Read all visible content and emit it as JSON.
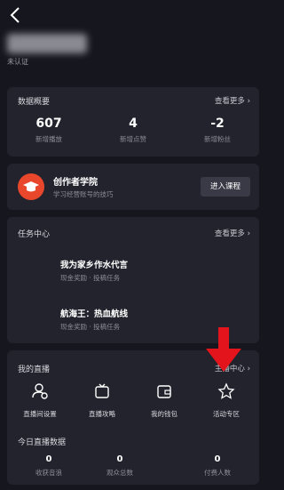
{
  "header": {
    "back_icon": "chevron-left-icon",
    "status": "未认证"
  },
  "data_overview": {
    "title": "数据概要",
    "more": "查看更多",
    "stats": [
      {
        "value": "607",
        "label": "新增播放"
      },
      {
        "value": "4",
        "label": "新增点赞"
      },
      {
        "value": "-2",
        "label": "新增粉丝"
      }
    ]
  },
  "academy": {
    "title": "创作者学院",
    "subtitle": "学习经营账号的技巧",
    "button": "进入课程",
    "icon": "graduation-cap-icon",
    "accent": "#e8472c"
  },
  "tasks": {
    "title": "任务中心",
    "more": "查看更多",
    "items": [
      {
        "title": "我为家乡作水代言",
        "subtitle": "现金奖励 · 投稿任务"
      },
      {
        "title": "航海王：热血航线",
        "subtitle": "现金奖励 · 投稿任务"
      }
    ]
  },
  "live": {
    "title": "我的直播",
    "more": "主播中心",
    "items": [
      {
        "label": "直播间设置",
        "icon": "user-settings-icon"
      },
      {
        "label": "直播攻略",
        "icon": "tv-icon"
      },
      {
        "label": "我的钱包",
        "icon": "wallet-icon"
      },
      {
        "label": "活动专区",
        "icon": "star-icon"
      }
    ],
    "arrow_color": "#e3141b"
  },
  "today_live": {
    "title": "今日直播数据",
    "stats": [
      {
        "value": "0",
        "label": "收获音浪"
      },
      {
        "value": "0",
        "label": "观众总数"
      },
      {
        "value": "0",
        "label": "付费人数"
      }
    ]
  }
}
